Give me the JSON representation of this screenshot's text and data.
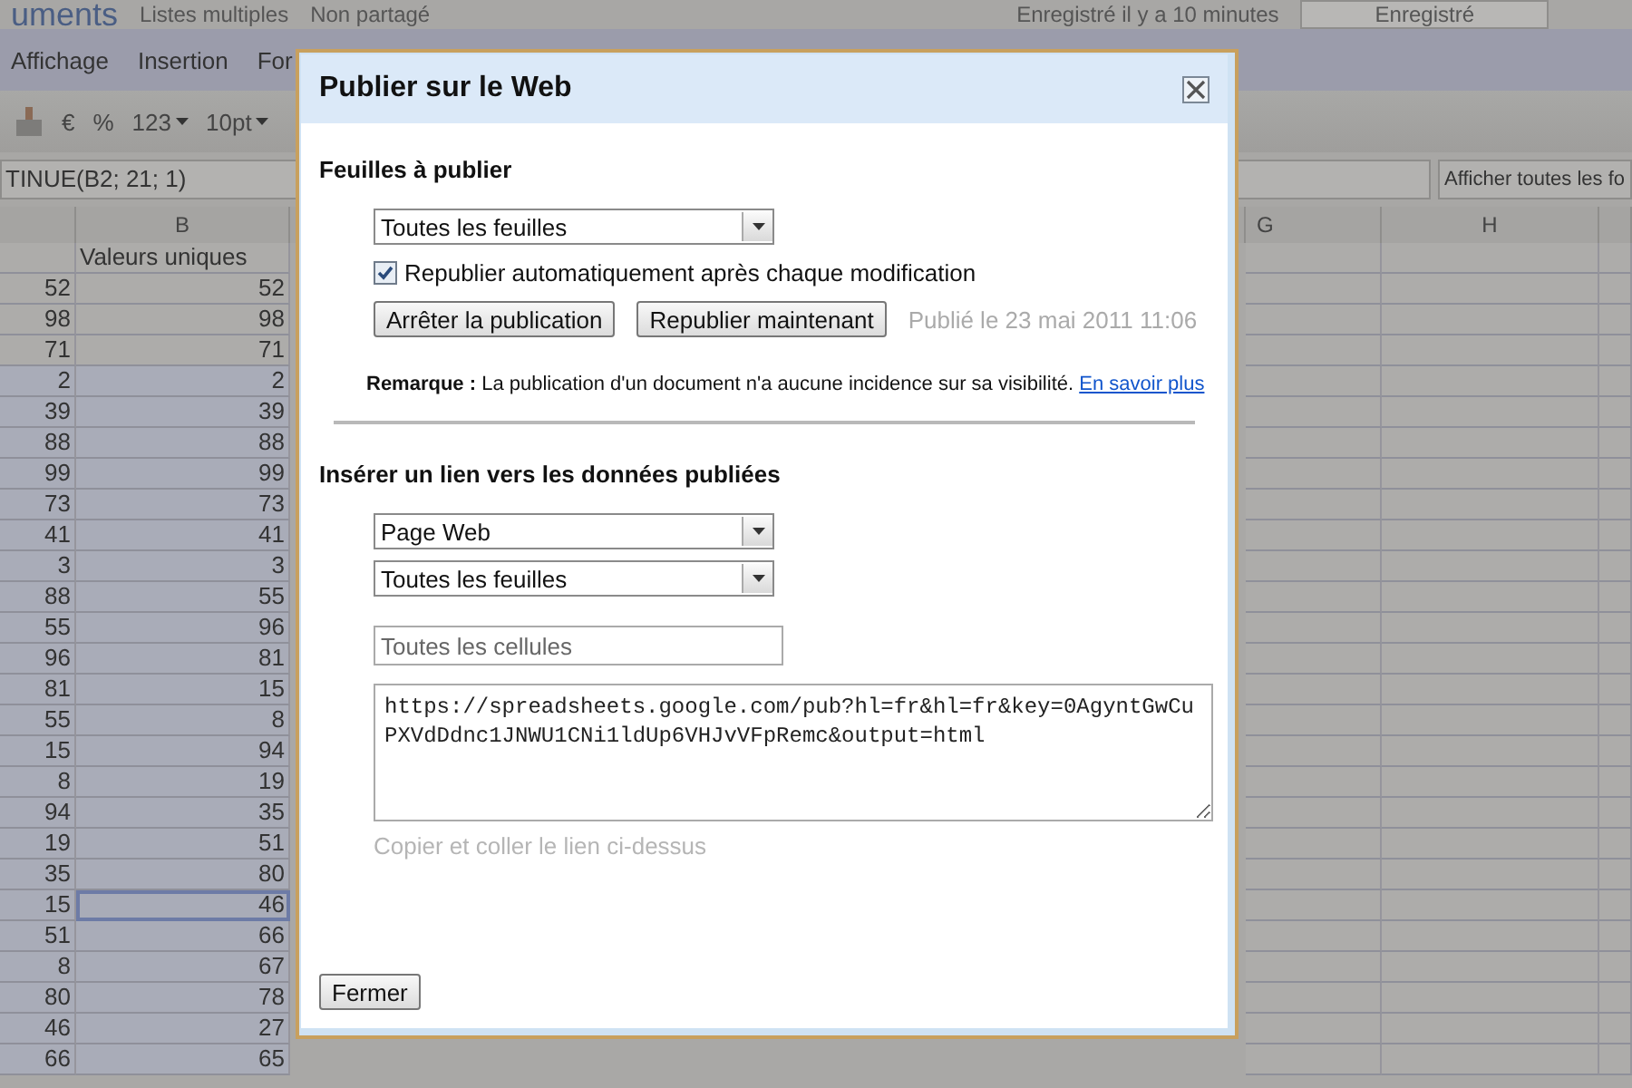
{
  "header": {
    "doc_title": "uments",
    "title": "Listes multiples",
    "sharing": "Non partagé",
    "save_status": "Enregistré il y a 10 minutes",
    "save_button": "Enregistré"
  },
  "menu": [
    "Affichage",
    "Insertion",
    "For"
  ],
  "toolbar": {
    "currency": "€",
    "percent": "%",
    "number_format": "123",
    "font_size": "10pt"
  },
  "formula_bar": {
    "value": "TINUE(B2; 21; 1)",
    "show_button": "Afficher toutes les fo"
  },
  "sheet": {
    "columns": [
      {
        "label": "B"
      },
      {
        "label": "G"
      },
      {
        "label": "H"
      }
    ],
    "header_row": "Valeurs uniques",
    "rows": [
      {
        "a": "52",
        "b": "52",
        "selected": false
      },
      {
        "a": "98",
        "b": "98",
        "selected": false
      },
      {
        "a": "71",
        "b": "71",
        "selected": false
      },
      {
        "a": "2",
        "b": "2",
        "selected": false
      },
      {
        "a": "39",
        "b": "39",
        "selected": false
      },
      {
        "a": "88",
        "b": "88",
        "selected": false
      },
      {
        "a": "99",
        "b": "99",
        "selected": false
      },
      {
        "a": "73",
        "b": "73",
        "selected": false
      },
      {
        "a": "41",
        "b": "41",
        "selected": false
      },
      {
        "a": "3",
        "b": "3",
        "selected": false
      },
      {
        "a": "88",
        "b": "55",
        "selected": false
      },
      {
        "a": "55",
        "b": "96",
        "selected": false
      },
      {
        "a": "96",
        "b": "81",
        "selected": false
      },
      {
        "a": "81",
        "b": "15",
        "selected": false
      },
      {
        "a": "55",
        "b": "8",
        "selected": false
      },
      {
        "a": "15",
        "b": "94",
        "selected": false
      },
      {
        "a": "8",
        "b": "19",
        "selected": false
      },
      {
        "a": "94",
        "b": "35",
        "selected": false
      },
      {
        "a": "19",
        "b": "51",
        "selected": false
      },
      {
        "a": "35",
        "b": "80",
        "selected": false
      },
      {
        "a": "15",
        "b": "46",
        "selected": true
      },
      {
        "a": "51",
        "b": "66",
        "selected": false
      },
      {
        "a": "8",
        "b": "67",
        "selected": false
      },
      {
        "a": "80",
        "b": "78",
        "selected": false
      },
      {
        "a": "46",
        "b": "27",
        "selected": false
      },
      {
        "a": "66",
        "b": "65",
        "selected": false
      }
    ]
  },
  "dialog": {
    "title": "Publier sur le Web",
    "publish_section": {
      "heading": "Feuilles à publier",
      "sheets_select": "Toutes les feuilles",
      "auto_republish": {
        "label": "Republier automatiquement après chaque modification",
        "checked": true
      },
      "buttons": [
        "Arrêter la publication",
        "Republier maintenant"
      ],
      "published_at": "Publié le 23 mai 2011 11:06",
      "note": "**Remarque :** La publication d'un document n'a aucune incidence sur sa visibilité.",
      "note_link": "En savoir plus"
    },
    "link_section": {
      "heading": "Insérer un lien vers les données publiées",
      "format_select": "Page Web",
      "sheet_select": "Toutes les feuilles",
      "range_placeholder": "Toutes les cellules",
      "link": "https://spreadsheets.google.com/pub?hl=fr&hl=fr&key=0AgyntGwCuPXVdDdnc1JNWU1CNi1ldUp6VHJvVFpRemc&output=html",
      "hint": "Copier et coller le lien ci-dessus"
    },
    "close_button": "Fermer"
  }
}
